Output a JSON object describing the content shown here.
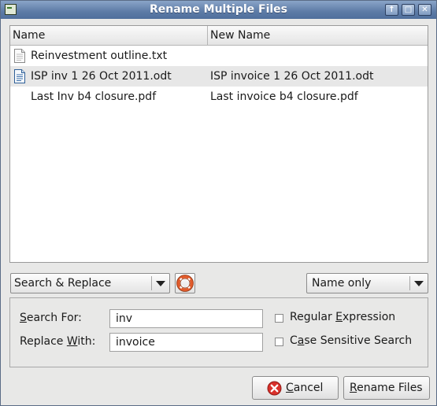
{
  "window": {
    "title": "Rename Multiple Files",
    "controls": {
      "minimize_glyph": "↑",
      "maximize_glyph": "□",
      "close_glyph": "✕"
    }
  },
  "file_list": {
    "columns": [
      "Name",
      "New Name"
    ],
    "rows": [
      {
        "name": "Reinvestment outline.txt",
        "new_name": "",
        "icon": "text-file-icon",
        "selected": false
      },
      {
        "name": "ISP inv 1 26 Oct 2011.odt",
        "new_name": "ISP invoice 1 26 Oct 2011.odt",
        "icon": "document-file-icon",
        "selected": true
      },
      {
        "name": "Last Inv b4 closure.pdf",
        "new_name": "Last invoice b4 closure.pdf",
        "icon": "none",
        "selected": false
      }
    ]
  },
  "mode_combo": {
    "value": "Search & Replace"
  },
  "scope_combo": {
    "value": "Name only"
  },
  "search": {
    "search_for_label_pre": "",
    "search_for_label_mn": "S",
    "search_for_label_post": "earch For:",
    "search_for_value": "inv",
    "replace_label_pre": "Replace ",
    "replace_label_mn": "W",
    "replace_label_post": "ith:",
    "replace_value": "invoice",
    "regex_label_pre": "Regular ",
    "regex_label_mn": "E",
    "regex_label_post": "xpression",
    "regex_checked": false,
    "case_label_pre": "C",
    "case_label_mn": "a",
    "case_label_post": "se Sensitive Search",
    "case_checked": false
  },
  "buttons": {
    "cancel_mn": "C",
    "cancel_rest": "ancel",
    "rename_mn": "R",
    "rename_rest": "ename Files"
  },
  "colors": {
    "titlebar": "#5d7ba6",
    "cancel_icon": "#d9302b",
    "help_ring": "#e15a2a"
  }
}
